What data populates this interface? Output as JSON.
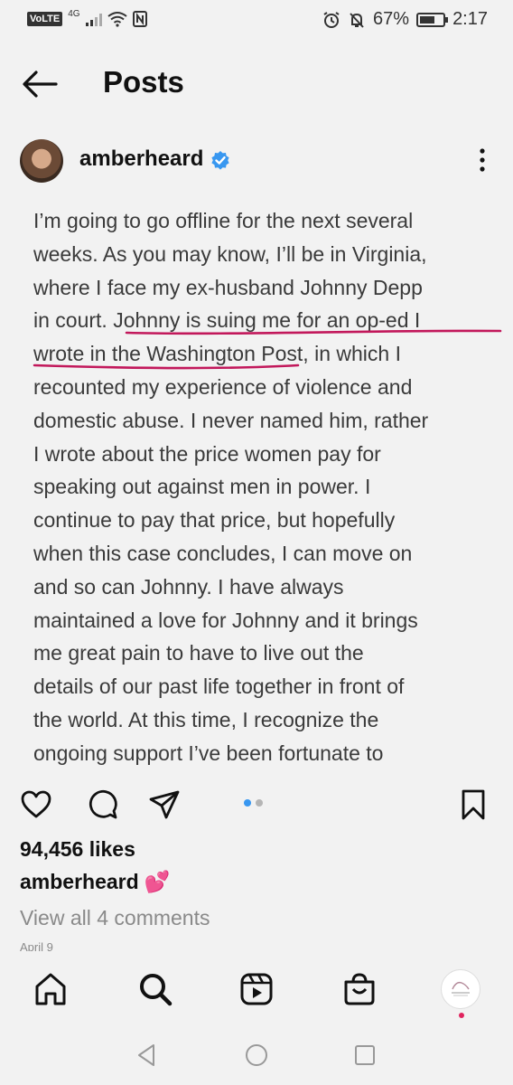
{
  "status_bar": {
    "volte": "VoLTE",
    "network": "4G",
    "battery": "67%",
    "battery_level": 0.67,
    "time": "2:17"
  },
  "header": {
    "title": "Posts"
  },
  "post": {
    "username": "amberheard",
    "verified": true,
    "caption": "I’m going to go offline for the next several weeks. As you may know,  I’ll be in Virginia, where I face my ex-husband Johnny Depp in court. Johnny is suing me for an op-ed I wrote in the Washington Post, in which I recounted my experience of violence and domestic abuse. I never named him, rather I wrote about the price women pay for speaking out against men in power. I continue to pay that price, but hopefully when this case concludes, I can move on and so can Johnny. I have always maintained a love for Johnny and it brings me great pain to have to live out the details of our past life together in front of the world. At this time, I recognize the ongoing support I’ve been fortunate to",
    "caption_lines": [
      "I’m going to go offline for the next several",
      "weeks. As you may know,  I’ll be in Virginia,",
      "where I face my ex-husband Johnny Depp",
      "in court. Johnny is suing me for an op-ed I",
      "wrote in the Washington Post, in which I",
      "recounted my experience of violence and",
      "domestic abuse. I never named him, rather",
      "I wrote about the price women pay for",
      "speaking out against men in power. I",
      "continue to pay that price, but hopefully",
      "when this case concludes, I can move on",
      "and so can Johnny. I have always",
      "maintained a love for Johnny and it brings",
      "me great pain to have to live out the",
      "details of our past life together in front of",
      "the world. At this time, I recognize the",
      "ongoing support I’ve been fortunate to"
    ],
    "likes": "94,456 likes",
    "caption_username": "amberheard",
    "caption_emoji": "💕",
    "view_comments": "View all 4 comments",
    "date": "April 9",
    "carousel_position": 1,
    "carousel_count": 2
  },
  "colors": {
    "accent_blue": "#3897f0",
    "annotation_pink": "#c2185b",
    "background": "#f2f2f2",
    "muted_text": "#8a8a8a"
  },
  "icons": {
    "header": [
      "back-arrow-icon"
    ],
    "actions": [
      "heart-icon",
      "comment-icon",
      "share-icon",
      "bookmark-icon"
    ],
    "bottom_nav": [
      "home-icon",
      "search-icon",
      "reels-icon",
      "shop-icon",
      "profile-avatar"
    ],
    "system_nav": [
      "back-triangle-icon",
      "home-circle-icon",
      "recents-square-icon"
    ]
  }
}
